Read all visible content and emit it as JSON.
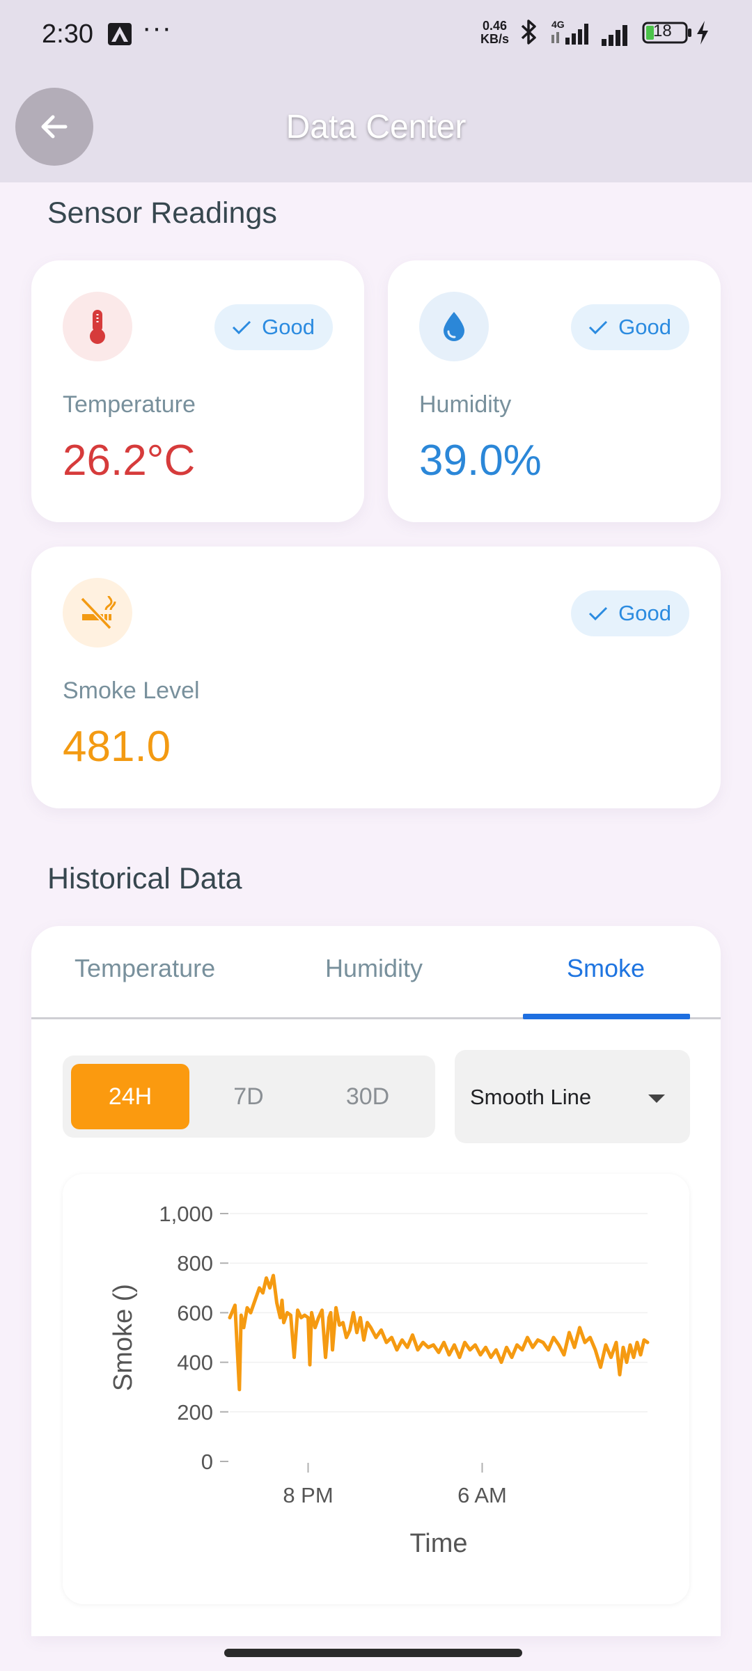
{
  "status_bar": {
    "time": "2:30",
    "more": "···",
    "net_speed_value": "0.46",
    "net_speed_unit": "KB/s",
    "network": "4G",
    "battery": "18",
    "icons": [
      "gallery-icon",
      "bluetooth-icon",
      "signal-icon",
      "battery-icon",
      "charging-icon"
    ]
  },
  "app_bar": {
    "title": "Data Center",
    "back_icon": "arrow-left-icon"
  },
  "sensor_section": {
    "title": "Sensor Readings",
    "cards": [
      {
        "label": "Temperature",
        "value": "26.2°C",
        "status": "Good",
        "icon": "thermometer-icon",
        "color": "#d63b3b",
        "icon_bg": "#fbe9e9"
      },
      {
        "label": "Humidity",
        "value": "39.0%",
        "status": "Good",
        "icon": "water-drop-icon",
        "color": "#2b87d8",
        "icon_bg": "#e6f0fa"
      },
      {
        "label": "Smoke Level",
        "value": "481.0",
        "status": "Good",
        "icon": "smoking-icon",
        "color": "#f39a12",
        "icon_bg": "#fff1e0"
      }
    ]
  },
  "history": {
    "title": "Historical Data",
    "tabs": [
      "Temperature",
      "Humidity",
      "Smoke"
    ],
    "active_tab": "Smoke",
    "ranges": [
      "24H",
      "7D",
      "30D"
    ],
    "active_range": "24H",
    "chart_style": "Smooth Line"
  },
  "chart_data": {
    "type": "line",
    "title": "",
    "xlabel": "Time",
    "ylabel": "Smoke ()",
    "ylim": [
      0,
      1000
    ],
    "yticks": [
      "0",
      "200",
      "400",
      "600",
      "800",
      "1,000"
    ],
    "xticks": [
      {
        "label": "8 PM",
        "x": 4.5
      },
      {
        "label": "6 AM",
        "x": 14.5
      }
    ],
    "xlim": [
      0,
      24
    ],
    "grid": true,
    "color": "#f59a11",
    "series": [
      {
        "x": [
          0.0,
          0.3,
          0.55,
          0.65,
          0.8,
          1.0,
          1.2,
          1.5,
          1.7,
          1.9,
          2.1,
          2.3,
          2.5,
          2.7,
          2.9,
          3.0,
          3.1,
          3.3,
          3.5,
          3.7,
          3.9,
          4.1,
          4.3,
          4.5,
          4.6,
          4.7,
          4.9,
          5.1,
          5.3,
          5.5,
          5.7,
          5.8,
          5.9,
          6.1,
          6.3,
          6.5,
          6.7,
          6.9,
          7.1,
          7.3,
          7.5,
          7.7,
          7.9,
          8.1,
          8.4,
          8.7,
          9.0,
          9.3,
          9.6,
          9.9,
          10.2,
          10.5,
          10.8,
          11.1,
          11.4,
          11.7,
          12.0,
          12.3,
          12.6,
          12.9,
          13.2,
          13.5,
          13.8,
          14.1,
          14.4,
          14.7,
          15.0,
          15.3,
          15.6,
          15.9,
          16.2,
          16.5,
          16.8,
          17.1,
          17.4,
          17.7,
          18.0,
          18.3,
          18.6,
          18.9,
          19.2,
          19.5,
          19.8,
          20.1,
          20.4,
          20.7,
          21.0,
          21.3,
          21.6,
          21.9,
          22.2,
          22.4,
          22.6,
          22.8,
          23.0,
          23.2,
          23.4,
          23.6,
          23.8,
          24.0
        ],
        "values": [
          580,
          630,
          290,
          590,
          540,
          620,
          600,
          660,
          700,
          680,
          740,
          700,
          750,
          640,
          580,
          650,
          560,
          600,
          590,
          420,
          610,
          580,
          590,
          580,
          390,
          600,
          540,
          580,
          610,
          420,
          580,
          600,
          450,
          620,
          550,
          560,
          500,
          530,
          600,
          520,
          580,
          490,
          560,
          540,
          500,
          530,
          480,
          500,
          450,
          490,
          460,
          510,
          450,
          480,
          460,
          470,
          440,
          480,
          430,
          470,
          420,
          480,
          450,
          470,
          430,
          460,
          420,
          450,
          400,
          460,
          420,
          470,
          450,
          500,
          460,
          490,
          480,
          450,
          500,
          470,
          430,
          520,
          460,
          540,
          480,
          500,
          450,
          380,
          470,
          420,
          480,
          350,
          460,
          400,
          470,
          420,
          480,
          430,
          490,
          480
        ]
      }
    ]
  }
}
